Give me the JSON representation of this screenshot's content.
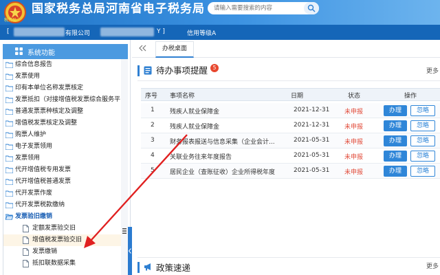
{
  "header": {
    "logo_text": "税务局",
    "title": "国家税务总局河南省电子税务局",
    "search_placeholder": "请输入需要搜索的内容"
  },
  "infobar": {
    "prefix": "[",
    "company_suffix": "有限公司",
    "code_suffix": "Y ]",
    "credit_level": "信用等级A"
  },
  "sidebar": {
    "header": "系统功能",
    "items": [
      {
        "label": "综合信息报告",
        "type": "folder"
      },
      {
        "label": "发票使用",
        "type": "folder"
      },
      {
        "label": "印有本单位名称发票核定",
        "type": "folder"
      },
      {
        "label": "发票抵扣（对接增值税发票综合服务平台）",
        "type": "folder"
      },
      {
        "label": "普通发票票种核定及调整",
        "type": "folder"
      },
      {
        "label": "增值税发票核定及调整",
        "type": "folder"
      },
      {
        "label": "购票人维护",
        "type": "folder"
      },
      {
        "label": "电子发票领用",
        "type": "folder"
      },
      {
        "label": "发票领用",
        "type": "folder"
      },
      {
        "label": "代开增值税专用发票",
        "type": "folder"
      },
      {
        "label": "代开增值税普通发票",
        "type": "folder"
      },
      {
        "label": "代开发票作废",
        "type": "folder"
      },
      {
        "label": "代开发票税款缴纳",
        "type": "folder"
      },
      {
        "label": "发票验旧缴销",
        "type": "open-folder"
      },
      {
        "label": "定额发票验交旧",
        "type": "file"
      },
      {
        "label": "增值税发票验交旧",
        "type": "file"
      },
      {
        "label": "发票缴销",
        "type": "file"
      },
      {
        "label": "抵扣联数据采集",
        "type": "file"
      }
    ]
  },
  "tabs": {
    "home": "办税桌面"
  },
  "todo": {
    "title": "待办事项提醒",
    "badge": "5",
    "more": "更多",
    "columns": [
      "序号",
      "事项名称",
      "日期",
      "状态",
      "操作"
    ],
    "rows": [
      {
        "no": "1",
        "name": "残疾人就业保障金",
        "date": "2021-12-31",
        "status": "未申报",
        "act": "办理",
        "ignore": "忽略"
      },
      {
        "no": "2",
        "name": "残疾人就业保障金",
        "date": "2021-12-31",
        "status": "未申报",
        "act": "办理",
        "ignore": "忽略"
      },
      {
        "no": "3",
        "name": "财务报表报送与信息采集（企业会计...",
        "date": "2021-05-31",
        "status": "未申报",
        "act": "办理",
        "ignore": "忽略"
      },
      {
        "no": "4",
        "name": "关联业务往来年度报告",
        "date": "2021-05-31",
        "status": "未申报",
        "act": "办理",
        "ignore": "忽略"
      },
      {
        "no": "5",
        "name": "居民企业（查账征收）企业所得税年度",
        "date": "2021-05-31",
        "status": "未申报",
        "act": "办理",
        "ignore": "忽略"
      }
    ]
  },
  "policy": {
    "title": "政策速递",
    "more": "更多"
  },
  "colors": {
    "brand_blue": "#1f73c6",
    "accent_blue": "#2f86d8",
    "status_red": "#e24b3a",
    "annotation_red": "#e02020"
  }
}
